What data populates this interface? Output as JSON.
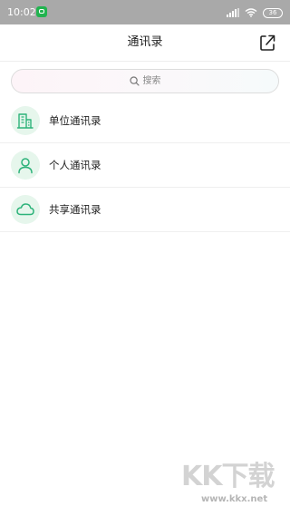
{
  "status_bar": {
    "time": "10:02",
    "battery": "36"
  },
  "header": {
    "title": "通讯录",
    "share_icon": "share-icon"
  },
  "search": {
    "placeholder": "搜索",
    "icon": "search-icon"
  },
  "list": {
    "items": [
      {
        "label": "单位通讯录",
        "icon": "building-icon"
      },
      {
        "label": "个人通讯录",
        "icon": "person-icon"
      },
      {
        "label": "共享通讯录",
        "icon": "cloud-icon"
      }
    ]
  },
  "watermark": {
    "logo": "KK下载",
    "url": "www.kkx.net"
  },
  "colors": {
    "accent": "#2db37a",
    "status_bar": "#a9a9a9",
    "icon_bg": "#e6f6ec"
  }
}
